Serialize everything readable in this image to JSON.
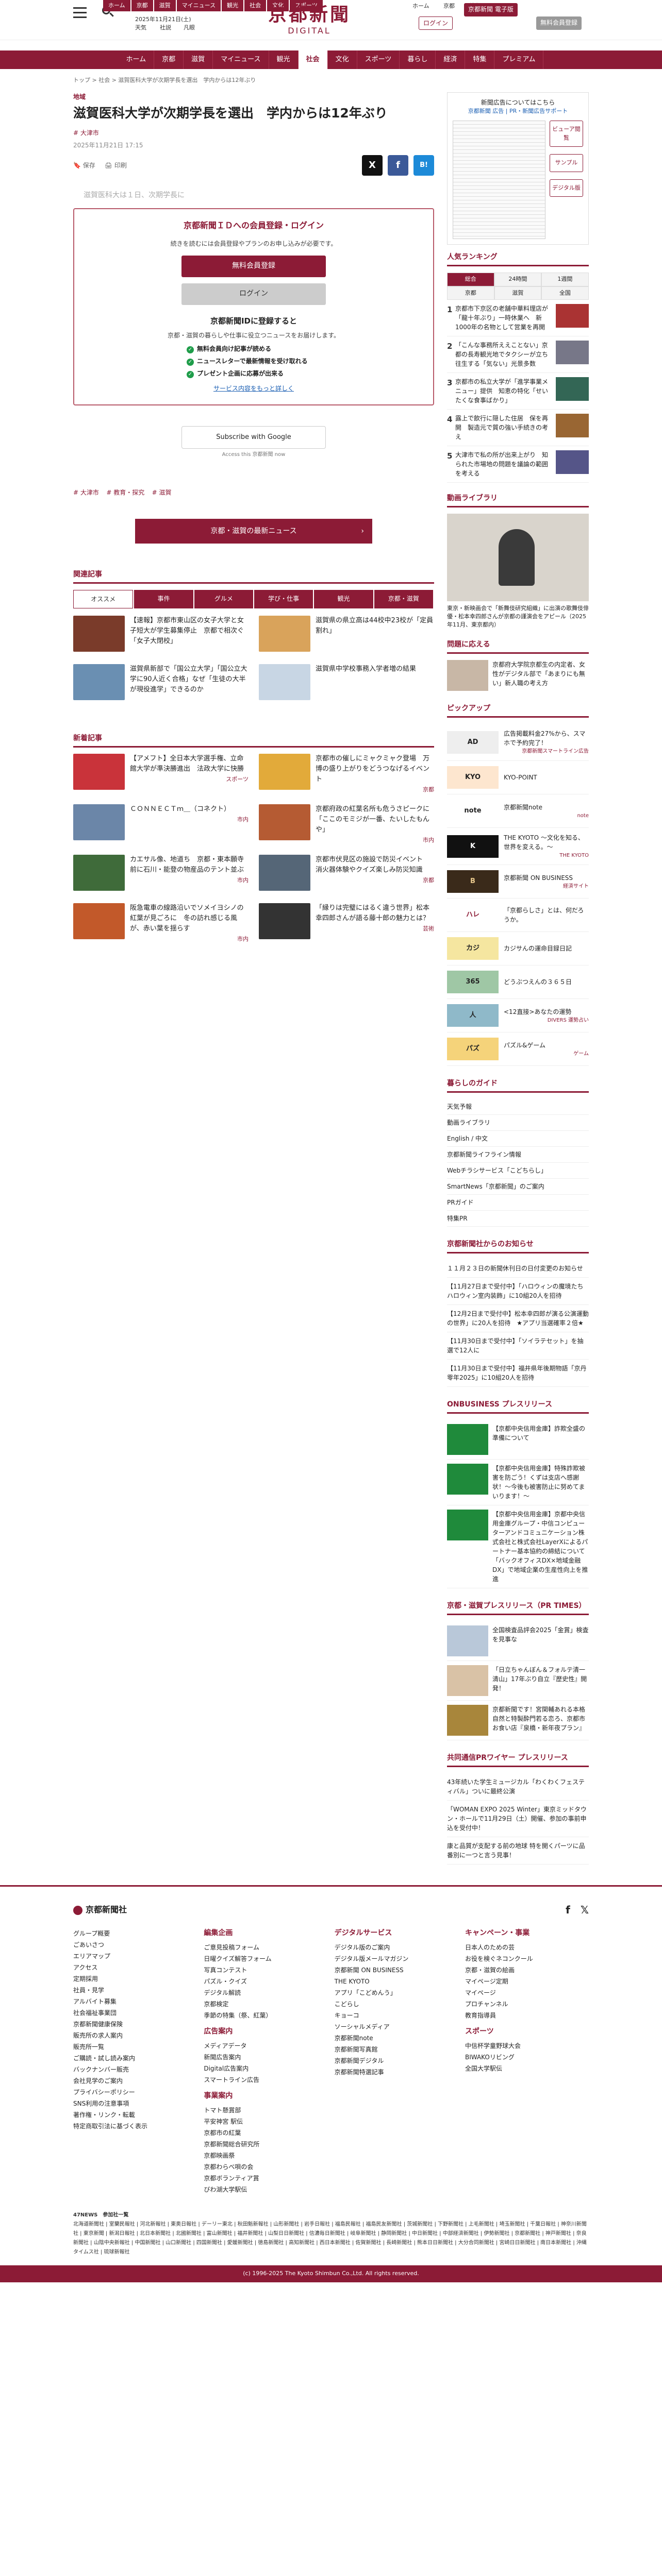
{
  "header": {
    "top_nav": [
      "ホーム",
      "京都",
      "滋賀",
      "マイニュース",
      "観光",
      "社会",
      "文化",
      "スポーツ"
    ],
    "date": "2025年11月21日(土)",
    "weather": "天気",
    "links": [
      "社説",
      "凡眼"
    ],
    "logo_jp": "京都新聞",
    "logo_en": "DIGITAL",
    "login": "ログイン",
    "register": "無料会員登録",
    "subscribe": "京都新聞 電子版",
    "kyoto_link": "ホーム",
    "right_links": [
      "京都",
      "特集"
    ]
  },
  "gnav": [
    "ホーム",
    "京都",
    "滋賀",
    "マイニュース",
    "観光",
    "社会",
    "文化",
    "スポーツ",
    "暮らし",
    "経済",
    "特集",
    "プレミアム"
  ],
  "gnav_active": "社会",
  "breadcrumb": "トップ > 社会 > 滋賀医科大学が次期学長を選出　学内からは12年ぶり",
  "article": {
    "category": "地域",
    "title": "滋賀医科大学が次期学長を選出　学内からは12年ぶり",
    "tags": [
      "# 大津市"
    ],
    "date": "2025年11月21日 17:15",
    "tools": [
      "保存",
      "印刷"
    ],
    "sns": [
      "X",
      "f",
      "B!"
    ],
    "lead": "滋賀医科大は１日、次期学長に",
    "gate": {
      "title": "京都新聞ＩＤへの会員登録・ログイン",
      "desc": "続きを読むには会員登録やプランのお申し込みが必要です。",
      "register_btn": "無料会員登録",
      "login_btn": "ログイン",
      "sub": "京都新聞IDに登録すると",
      "note": "京都・滋賀の暮らしや仕事に役立つニュースをお届けします。",
      "benefits": [
        "無料会員向け記事が読める",
        "ニュースレターで最新情報を受け取れる",
        "プレゼント企画に応募が出来る"
      ],
      "more": "サービス内容をもっと詳しく"
    },
    "google": {
      "btn": "Subscribe with Google",
      "sub": "Access this 京都新聞 now"
    },
    "bottom_tags": [
      "# 大津市",
      "# 教育・探究",
      "# 滋賀"
    ],
    "more_btn": "京都・滋賀の最新ニュース"
  },
  "related": {
    "heading": "関連記事",
    "tabs": [
      "オススメ",
      "事件",
      "グルメ",
      "学び・仕事",
      "観光",
      "京都・滋賀"
    ],
    "items": [
      {
        "text": "【速報】京都市東山区の女子大学と女子短大が学生募集停止　京都で相次ぐ「女子大閉校」",
        "color": "#7a3b2a"
      },
      {
        "text": "滋賀県の県立高は44校中23校が「定員割れ」",
        "color": "#d9a35b"
      },
      {
        "text": "滋賀県新部で「国公立大学」「国公立大学に90人近く合格」なぜ「生徒の大半が現役進学」できるのか",
        "color": "#6a8fb2"
      },
      {
        "text": "滋賀県中学校事務入学者増の結果",
        "color": "#c8d6e4"
      }
    ]
  },
  "new_articles": {
    "heading": "新着記事",
    "items": [
      {
        "text": "【アメフト】全日本大学選手権、立命館大学が準決勝進出　法政大学に快勝",
        "sub": "スポーツ",
        "color": "#c9333a"
      },
      {
        "text": "京都市の催しにミャクミャク登場　万博の盛り上がりをどうつなげるイベント",
        "sub": "京都",
        "color": "#e2aa3a"
      },
      {
        "text": "ＣＯＮＮＥＣＴｍ＿（コネクト）",
        "sub": "市内",
        "color": "#6b86a8"
      },
      {
        "text": "京都府政の紅葉名所も危うさピークに「ここのモミジが一番、たいしたもんや」",
        "sub": "市内",
        "color": "#b55b33"
      },
      {
        "text": "カエサル像、地道ち　京都・東本願寺前に石川・能登の物産品のテント並ぶ",
        "sub": "市内",
        "color": "#3f6b3a"
      },
      {
        "text": "京都市伏見区の施設で防災イベント　消火器体験やクイズ楽しみ防災知識",
        "sub": "京都",
        "color": "#556677"
      },
      {
        "text": "阪急電車の線路沿いでソメイヨシノの紅葉が見ごろに　冬の訪れ感じる風が、赤い葉を揺らす",
        "sub": "市内",
        "color": "#c2592a"
      },
      {
        "text": "「縁りは完璧にはるく違う世界」松本幸四郎さんが語る藤十郎の魅力とは？",
        "sub": "芸術",
        "color": "#333"
      }
    ]
  },
  "side": {
    "paper": {
      "title": "新聞広告についてはこちら",
      "links": [
        "京都新聞 広告",
        "PR・新聞広告サポート"
      ],
      "buttons": [
        "ビューア閲覧",
        "サンプル",
        "デジタル版"
      ]
    },
    "ranking": {
      "heading": "人気ランキング",
      "tabs": [
        "総合",
        "24時間",
        "1週間",
        "京都",
        "滋賀",
        "全国"
      ],
      "items": [
        {
          "n": "1",
          "t": "京都市下京区の老舗中華料理店が「龍十年ぶり」一時休業へ　新1000年の名物として営業を再開",
          "c": "#a33"
        },
        {
          "n": "2",
          "t": "「こんな事務所ええことない」京都の長寿観光地でタクシーが立ち往生する「気ない」光景多数",
          "c": "#778"
        },
        {
          "n": "3",
          "t": "京都市の私立大学が「進学事業メニュー」提供　知恵の特化「せいたくな食事ばかり」",
          "c": "#365"
        },
        {
          "n": "4",
          "t": "露上で飲行に隠した住居　保を再開　製造元で質の強い手続きの考え",
          "c": "#963"
        },
        {
          "n": "5",
          "t": "大津市で私の所が出来上がり　知られた市場地の問題を議論の範囲を考える",
          "c": "#558"
        }
      ]
    },
    "video": {
      "heading": "動画ライブラリ",
      "caption": "東京・新映画会で「新舞伎研究組織」に出演の歌舞伎俳優・松本幸四郎さんが京都の謹演会をアピール（2025年11月、東京都内）"
    },
    "quiz": {
      "heading": "問題に応える",
      "text": "京都府大学院京都生の内定者、女性がデジタル部で「あまりにも無い」新人職の考え方"
    },
    "pickup": {
      "heading": "ピックアップ",
      "items": [
        {
          "ic": "AD",
          "text": "広告掲載料金27%から、スマホで予約完了！",
          "ft": "京都新聞スマートライン広告",
          "color": "#eee"
        },
        {
          "ic": "KYO",
          "text": "KYO-POINT",
          "ft": "",
          "color": "#fde6cf"
        },
        {
          "ic": "note",
          "text": "京都新聞note",
          "ft": "note",
          "color": "#fff"
        },
        {
          "ic": "K",
          "text": "THE KYOTO ～文化を知る、世界を変える。～",
          "ft": "THE KYOTO",
          "color": "#111"
        },
        {
          "ic": "B",
          "text": "京都新聞 ON BUSINESS",
          "ft": "経済サイト",
          "color": "#3a2a1a"
        },
        {
          "ic": "ハレ",
          "text": "「京都らしさ」とは、何だろうか。",
          "ft": "",
          "color": "#fff"
        },
        {
          "ic": "カジ",
          "text": "カジサんの運命目録日記",
          "ft": "",
          "color": "#f5e6a0"
        },
        {
          "ic": "365",
          "text": "どうぶつえんの３６５日",
          "ft": "",
          "color": "#9fc7a5"
        },
        {
          "ic": "人",
          "text": "<12直接>あなたの運勢",
          "ft": "DIVERS 運勢占い",
          "color": "#8fb9c9"
        },
        {
          "ic": "パズ",
          "text": "パズル&ゲーム",
          "ft": "ゲーム",
          "color": "#f5d37a"
        }
      ]
    },
    "guide": {
      "heading": "暮らしのガイド",
      "items": [
        "天気予報",
        "動画ライブラリ",
        "English / 中文",
        "京都新聞ライフライン情報",
        "Webチラシサービス「こどちらし」",
        "SmartNews「京都新聞」のご案内",
        "PRガイド",
        "特集PR"
      ]
    },
    "notice": {
      "heading": "京都新聞社からのお知らせ",
      "items": [
        "１１月２３日の新聞休刊日の日付変更のお知らせ",
        "【11月27日まで受付中】「ハロウィンの魔境たちハロウィン室内装飾」に10組20人を招待",
        "【12月2日まで受付中】松本幸四郎が演る公演運動の世界」に20人を招待　★アプリ当選確率２倍★",
        "【11月30日まで受付中】「ソイラテセット」を抽選で12人に",
        "【11月30日まで受付中】福井県年後期物語「京丹零年2025」に10組20人を招待"
      ]
    },
    "onbiz": {
      "heading": "ONBUSINESS プレスリリース",
      "items": [
        "【京都中央信用金庫】詐欺全盛の準備について",
        "【京都中央信用金庫】特殊詐欺被害を防ごう！くずは支店へ感謝状！～今後も被害防止に努めてまいります！～",
        "【京都中央信用金庫】京都中央信用金庫グループ・中信コンピューターアンドコミュニケーション株式会社と株式会社LayerXによるパートナー基本協約の締結について「バックオフィスDX×地域金融DX」で地域企業の生産性向上を推進"
      ]
    },
    "prtimes": {
      "heading": "京都・滋賀プレスリリース（PR TIMES）",
      "items": [
        {
          "t": "全国検査品評会2025「金賞」検査を見事な",
          "c": "#b9c8d9"
        },
        {
          "t": "「日立ちゃんぼん＆フォルテ清一清山」17年ぶり自立『歴史性』開発！",
          "c": "#d9c2a6"
        },
        {
          "t": "京都新聞です！宮関輔あれる本格自然と特製酔門若る恋ろ、京都市お食い店『泉橋・新年夜プラン』",
          "c": "#a8863b"
        }
      ]
    },
    "kyodo": {
      "heading": "共同通信PRワイヤー プレスリリース",
      "items": [
        "43年続いた学生ミュージカル「わくわくフェスティバル」ついに最終公演",
        "「WOMAN EXPO 2025 Winter」東京ミッドタウン・ホールで11月29日（土）開催、参加の事前申込を受付中！",
        "康と品質が支配する前の地球 特を開くパーツに品番別に一つと言う見事！"
      ]
    }
  },
  "footer": {
    "logo": "京都新聞社",
    "cols": [
      {
        "h": "",
        "items": [
          "グループ概要",
          "ごあいさつ",
          "エリアマップ",
          "アクセス",
          "定期採用",
          "社員・見学",
          "アルバイト募集",
          "社会福祉事業団",
          "京都新聞健康保険",
          "販売所の求人案内",
          "販売所一覧",
          "ご購読・試し読み案内",
          "バックナンバー販売",
          "会社見学のご案内",
          "プライバシーポリシー",
          "SNS利用の注意事項",
          "著作権・リンク・転載",
          "特定商取引法に基づく表示"
        ]
      },
      {
        "h": "編集企画",
        "items": [
          "ご意見投稿フォーム",
          "日曜クイズ解答フォーム",
          "写真コンテスト",
          "パズル・クイズ",
          "デジタル解読",
          "京都検定",
          "季節の特集（祭、紅葉）"
        ],
        "h2": "広告案内",
        "items2": [
          "メディアデータ",
          "新聞広告案内",
          "Digital広告案内",
          "スマートライン広告"
        ],
        "h3": "事業案内",
        "items3": [
          "トマト懸賞部",
          "平安神宮 駅伝",
          "京都市の紅葉",
          "京都新聞総合研究所",
          "京都映画祭",
          "京都わらべ唄の会",
          "京都ボランティア賞",
          "びわ湖大学駅伝"
        ]
      },
      {
        "h": "デジタルサービス",
        "items": [
          "デジタル版のご案内",
          "デジタル版メールマガジン",
          "京都新聞 ON BUSINESS",
          "THE KYOTO",
          "アプリ「こどめんう」",
          "こどらし",
          "キョーコ",
          "ソーシャルメディア",
          "京都新聞note",
          "京都新聞写真館",
          "京都新聞デジタル",
          "京都新聞特選記事"
        ]
      },
      {
        "h": "キャンペーン・事業",
        "items": [
          "日本人のための芸",
          "お役を検ぐネコンクール",
          "京都・滋賀の絵画",
          "マイページ定期",
          "マイページ",
          "プロチャンネル",
          "教育指導員"
        ],
        "h2": "スポーツ",
        "items2": [
          "中信杯学童野球大会",
          "BIWAKOリビング",
          "全国大学駅伝"
        ]
      }
    ],
    "network_label": "47NEWS　参加社一覧",
    "network": "北海道新聞社 | 室蘭民報社 | 河北新報社 | 東奥日報社 | デーリー東北 | 秋田魁新報社 | 山形新聞社 | 岩手日報社 | 福島民報社 | 福島民友新聞社 | 茨城新聞社 | 下野新聞社 | 上毛新聞社 | 埼玉新聞社 | 千葉日報社 | 神奈川新聞社 | 東京新聞 | 新潟日報社 | 北日本新聞社 | 北國新聞社 | 富山新聞社 | 福井新聞社 | 山梨日日新聞社 | 信濃毎日新聞社 | 岐阜新聞社 | 静岡新聞社 | 中日新聞社 | 中部経済新聞社 | 伊勢新聞社 | 京都新聞社 | 神戸新聞社 | 奈良新聞社 | 山陰中央新報社 | 中国新聞社 | 山口新聞社 | 四国新聞社 | 愛媛新聞社 | 徳島新聞社 | 高知新聞社 | 西日本新聞社 | 佐賀新聞社 | 長崎新聞社 | 熊本日日新聞社 | 大分合同新聞社 | 宮崎日日新聞社 | 南日本新聞社 | 沖縄タイムス社 | 琉球新報社",
    "copyright": "(c) 1996-2025 The Kyoto Shimbun Co.,Ltd. All rights reserved."
  }
}
